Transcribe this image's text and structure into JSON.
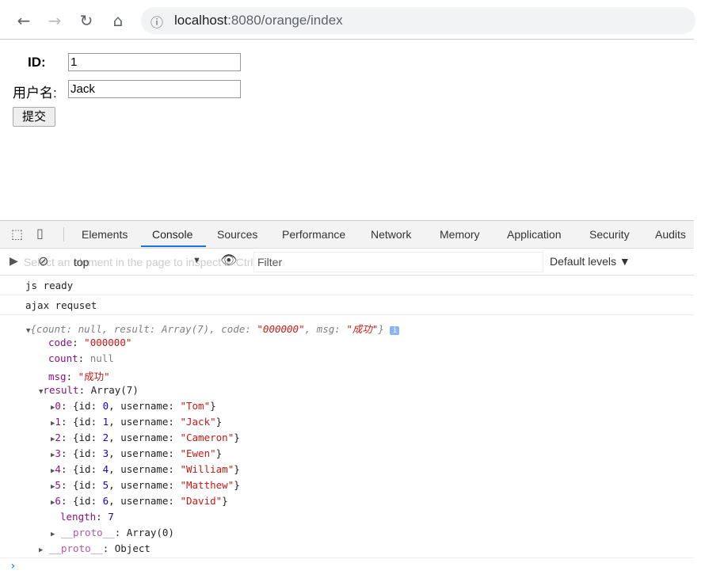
{
  "browser": {
    "url_host": "localhost",
    "url_path": ":8080/orange/index"
  },
  "form": {
    "id_label": "ID:",
    "id_value": "1",
    "username_label": "用户名:",
    "username_value": "Jack",
    "submit_label": "提交"
  },
  "devtools": {
    "tabs": [
      "Elements",
      "Console",
      "Sources",
      "Performance",
      "Network",
      "Memory",
      "Application",
      "Security",
      "Audits"
    ],
    "active_tab": "Console",
    "context": "top",
    "filter_placeholder": "Filter",
    "levels": "Default levels ▼",
    "tooltip": "Select an element in the page to inspect it  Ctrl + Shift + C",
    "logs": [
      "js ready",
      "ajax requset"
    ],
    "object": {
      "summary_pre": "{count: null, result: Array(7), code: ",
      "summary_code": "\"000000\"",
      "summary_mid": ", msg: ",
      "summary_msg": "\"成功\"",
      "summary_end": "}",
      "code_key": "code",
      "code_val": "\"000000\"",
      "count_key": "count",
      "count_val": "null",
      "msg_key": "msg",
      "msg_val": "\"成功\"",
      "result_key": "result",
      "result_val": "Array(7)",
      "items": [
        {
          "idx": "0",
          "id": "0",
          "username": "\"Tom\""
        },
        {
          "idx": "1",
          "id": "1",
          "username": "\"Jack\""
        },
        {
          "idx": "2",
          "id": "2",
          "username": "\"Cameron\""
        },
        {
          "idx": "3",
          "id": "3",
          "username": "\"Ewen\""
        },
        {
          "idx": "4",
          "id": "4",
          "username": "\"William\""
        },
        {
          "idx": "5",
          "id": "5",
          "username": "\"Matthew\""
        },
        {
          "idx": "6",
          "id": "6",
          "username": "\"David\""
        }
      ],
      "length_key": "length",
      "length_val": "7",
      "array_proto": "__proto__",
      "array_proto_val": "Array(0)",
      "obj_proto": "__proto__",
      "obj_proto_val": "Object"
    }
  }
}
